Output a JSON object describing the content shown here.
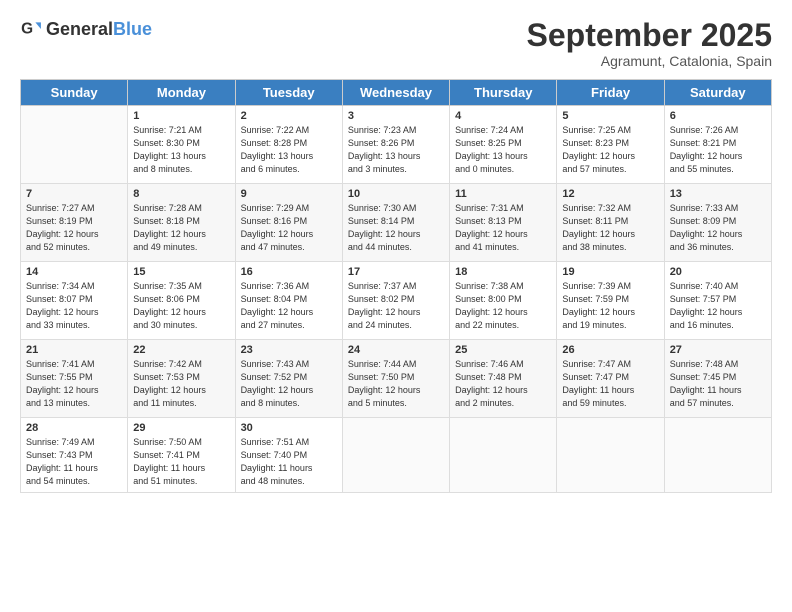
{
  "logo": {
    "general": "General",
    "blue": "Blue"
  },
  "title": "September 2025",
  "subtitle": "Agramunt, Catalonia, Spain",
  "days_header": [
    "Sunday",
    "Monday",
    "Tuesday",
    "Wednesday",
    "Thursday",
    "Friday",
    "Saturday"
  ],
  "weeks": [
    [
      {
        "day": "",
        "info": ""
      },
      {
        "day": "1",
        "info": "Sunrise: 7:21 AM\nSunset: 8:30 PM\nDaylight: 13 hours\nand 8 minutes."
      },
      {
        "day": "2",
        "info": "Sunrise: 7:22 AM\nSunset: 8:28 PM\nDaylight: 13 hours\nand 6 minutes."
      },
      {
        "day": "3",
        "info": "Sunrise: 7:23 AM\nSunset: 8:26 PM\nDaylight: 13 hours\nand 3 minutes."
      },
      {
        "day": "4",
        "info": "Sunrise: 7:24 AM\nSunset: 8:25 PM\nDaylight: 13 hours\nand 0 minutes."
      },
      {
        "day": "5",
        "info": "Sunrise: 7:25 AM\nSunset: 8:23 PM\nDaylight: 12 hours\nand 57 minutes."
      },
      {
        "day": "6",
        "info": "Sunrise: 7:26 AM\nSunset: 8:21 PM\nDaylight: 12 hours\nand 55 minutes."
      }
    ],
    [
      {
        "day": "7",
        "info": "Sunrise: 7:27 AM\nSunset: 8:19 PM\nDaylight: 12 hours\nand 52 minutes."
      },
      {
        "day": "8",
        "info": "Sunrise: 7:28 AM\nSunset: 8:18 PM\nDaylight: 12 hours\nand 49 minutes."
      },
      {
        "day": "9",
        "info": "Sunrise: 7:29 AM\nSunset: 8:16 PM\nDaylight: 12 hours\nand 47 minutes."
      },
      {
        "day": "10",
        "info": "Sunrise: 7:30 AM\nSunset: 8:14 PM\nDaylight: 12 hours\nand 44 minutes."
      },
      {
        "day": "11",
        "info": "Sunrise: 7:31 AM\nSunset: 8:13 PM\nDaylight: 12 hours\nand 41 minutes."
      },
      {
        "day": "12",
        "info": "Sunrise: 7:32 AM\nSunset: 8:11 PM\nDaylight: 12 hours\nand 38 minutes."
      },
      {
        "day": "13",
        "info": "Sunrise: 7:33 AM\nSunset: 8:09 PM\nDaylight: 12 hours\nand 36 minutes."
      }
    ],
    [
      {
        "day": "14",
        "info": "Sunrise: 7:34 AM\nSunset: 8:07 PM\nDaylight: 12 hours\nand 33 minutes."
      },
      {
        "day": "15",
        "info": "Sunrise: 7:35 AM\nSunset: 8:06 PM\nDaylight: 12 hours\nand 30 minutes."
      },
      {
        "day": "16",
        "info": "Sunrise: 7:36 AM\nSunset: 8:04 PM\nDaylight: 12 hours\nand 27 minutes."
      },
      {
        "day": "17",
        "info": "Sunrise: 7:37 AM\nSunset: 8:02 PM\nDaylight: 12 hours\nand 24 minutes."
      },
      {
        "day": "18",
        "info": "Sunrise: 7:38 AM\nSunset: 8:00 PM\nDaylight: 12 hours\nand 22 minutes."
      },
      {
        "day": "19",
        "info": "Sunrise: 7:39 AM\nSunset: 7:59 PM\nDaylight: 12 hours\nand 19 minutes."
      },
      {
        "day": "20",
        "info": "Sunrise: 7:40 AM\nSunset: 7:57 PM\nDaylight: 12 hours\nand 16 minutes."
      }
    ],
    [
      {
        "day": "21",
        "info": "Sunrise: 7:41 AM\nSunset: 7:55 PM\nDaylight: 12 hours\nand 13 minutes."
      },
      {
        "day": "22",
        "info": "Sunrise: 7:42 AM\nSunset: 7:53 PM\nDaylight: 12 hours\nand 11 minutes."
      },
      {
        "day": "23",
        "info": "Sunrise: 7:43 AM\nSunset: 7:52 PM\nDaylight: 12 hours\nand 8 minutes."
      },
      {
        "day": "24",
        "info": "Sunrise: 7:44 AM\nSunset: 7:50 PM\nDaylight: 12 hours\nand 5 minutes."
      },
      {
        "day": "25",
        "info": "Sunrise: 7:46 AM\nSunset: 7:48 PM\nDaylight: 12 hours\nand 2 minutes."
      },
      {
        "day": "26",
        "info": "Sunrise: 7:47 AM\nSunset: 7:47 PM\nDaylight: 11 hours\nand 59 minutes."
      },
      {
        "day": "27",
        "info": "Sunrise: 7:48 AM\nSunset: 7:45 PM\nDaylight: 11 hours\nand 57 minutes."
      }
    ],
    [
      {
        "day": "28",
        "info": "Sunrise: 7:49 AM\nSunset: 7:43 PM\nDaylight: 11 hours\nand 54 minutes."
      },
      {
        "day": "29",
        "info": "Sunrise: 7:50 AM\nSunset: 7:41 PM\nDaylight: 11 hours\nand 51 minutes."
      },
      {
        "day": "30",
        "info": "Sunrise: 7:51 AM\nSunset: 7:40 PM\nDaylight: 11 hours\nand 48 minutes."
      },
      {
        "day": "",
        "info": ""
      },
      {
        "day": "",
        "info": ""
      },
      {
        "day": "",
        "info": ""
      },
      {
        "day": "",
        "info": ""
      }
    ]
  ]
}
